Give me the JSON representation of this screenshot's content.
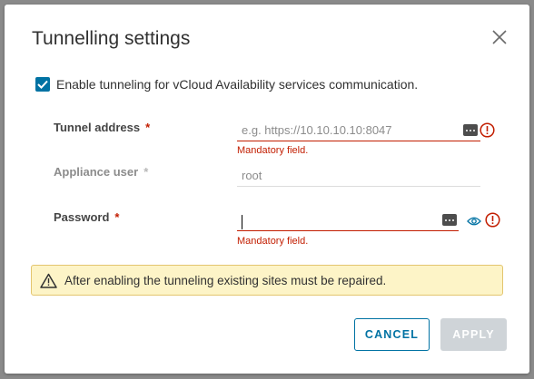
{
  "dialog": {
    "title": "Tunnelling settings",
    "enable_label": "Enable tunneling for vCloud Availability services communication.",
    "enable_checked": true
  },
  "fields": {
    "tunnel_address": {
      "label": "Tunnel address",
      "required_mark": "*",
      "placeholder": "e.g. https://10.10.10.10:8047",
      "value": "",
      "error": "Mandatory field."
    },
    "appliance_user": {
      "label": "Appliance user",
      "required_mark": "*",
      "value": "root"
    },
    "password": {
      "label": "Password",
      "required_mark": "*",
      "value": "",
      "error": "Mandatory field."
    }
  },
  "alert": {
    "text": "After enabling the tunneling existing sites must be repaired."
  },
  "buttons": {
    "cancel": "CANCEL",
    "apply": "APPLY"
  },
  "colors": {
    "accent": "#0072a3",
    "error": "#c21d00",
    "warning_bg": "#fdf4c7",
    "disabled_button": "#cfd4d8"
  },
  "icons": {
    "close": "close-icon",
    "checkbox": "check-icon",
    "error": "exclamation-circle-icon",
    "password_manager": "ellipsis-icon",
    "show_password": "eye-icon",
    "warning": "warning-triangle-icon"
  }
}
